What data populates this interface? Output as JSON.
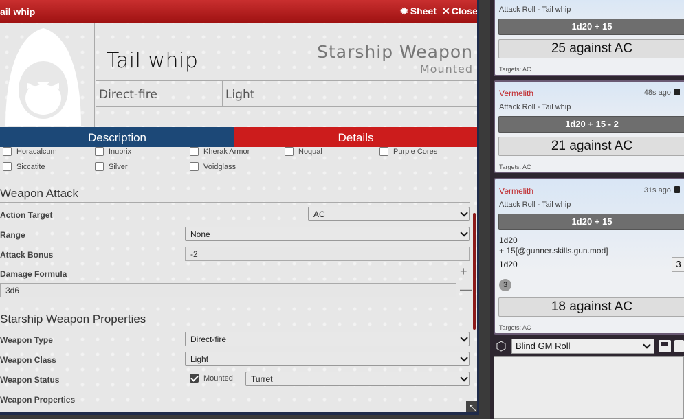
{
  "sheet": {
    "window_title": "ail whip",
    "sheet_label": "Sheet",
    "close_label": "Close",
    "item_name": "Tail whip",
    "item_type": "Starship Weapon",
    "item_subtype": "Mounted",
    "header_cells": [
      "Direct-fire",
      "Light"
    ],
    "tabs": {
      "description": "Description",
      "details": "Details"
    },
    "materials_row1": [
      "Horacalcum",
      "Inubrix",
      "Kherak Armor",
      "Noqual",
      "Purple Cores"
    ],
    "materials_row2": [
      "Siccatite",
      "Silver",
      "Voidglass"
    ],
    "weapon_attack": {
      "title": "Weapon Attack",
      "action_target_label": "Action Target",
      "action_target_value": "AC",
      "range_label": "Range",
      "range_value": "None",
      "attack_bonus_label": "Attack Bonus",
      "attack_bonus_value": "-2",
      "damage_formula_label": "Damage Formula",
      "damage_formula_value": "3d6",
      "plus": "+",
      "minus": "—"
    },
    "properties": {
      "title": "Starship Weapon Properties",
      "weapon_type_label": "Weapon Type",
      "weapon_type_value": "Direct-fire",
      "weapon_class_label": "Weapon Class",
      "weapon_class_value": "Light",
      "weapon_status_label": "Weapon Status",
      "mounted_label": "Mounted",
      "mounted_checked": true,
      "status_value": "Turret",
      "weapon_properties_label": "Weapon Properties"
    }
  },
  "chat": {
    "messages": [
      {
        "flavor": "Attack Roll - Tail whip",
        "formula": "1d20 + 15",
        "total": "25 against AC",
        "targets": "Targets: AC"
      },
      {
        "author": "Vermelith",
        "time": "48s ago",
        "flavor": "Attack Roll - Tail whip",
        "formula": "1d20 + 15 - 2",
        "total": "21 against AC",
        "targets": "Targets: AC"
      },
      {
        "author": "Vermelith",
        "time": "31s ago",
        "flavor": "Attack Roll - Tail whip",
        "formula": "1d20 + 15",
        "breakdown_line1": "1d20",
        "breakdown_line2": "+ 15[@gunner.skills.gun.mod]",
        "die_label": "1d20",
        "die_result": "3",
        "die_face": "3",
        "total": "18 against AC",
        "targets": "Targets: AC"
      }
    ],
    "roll_mode": "Blind GM Roll"
  },
  "colors": {
    "title_red": "#c92f2f",
    "tab_blue": "#1c4877",
    "tab_red": "#cc1c1c",
    "author_red": "#c0282b"
  }
}
